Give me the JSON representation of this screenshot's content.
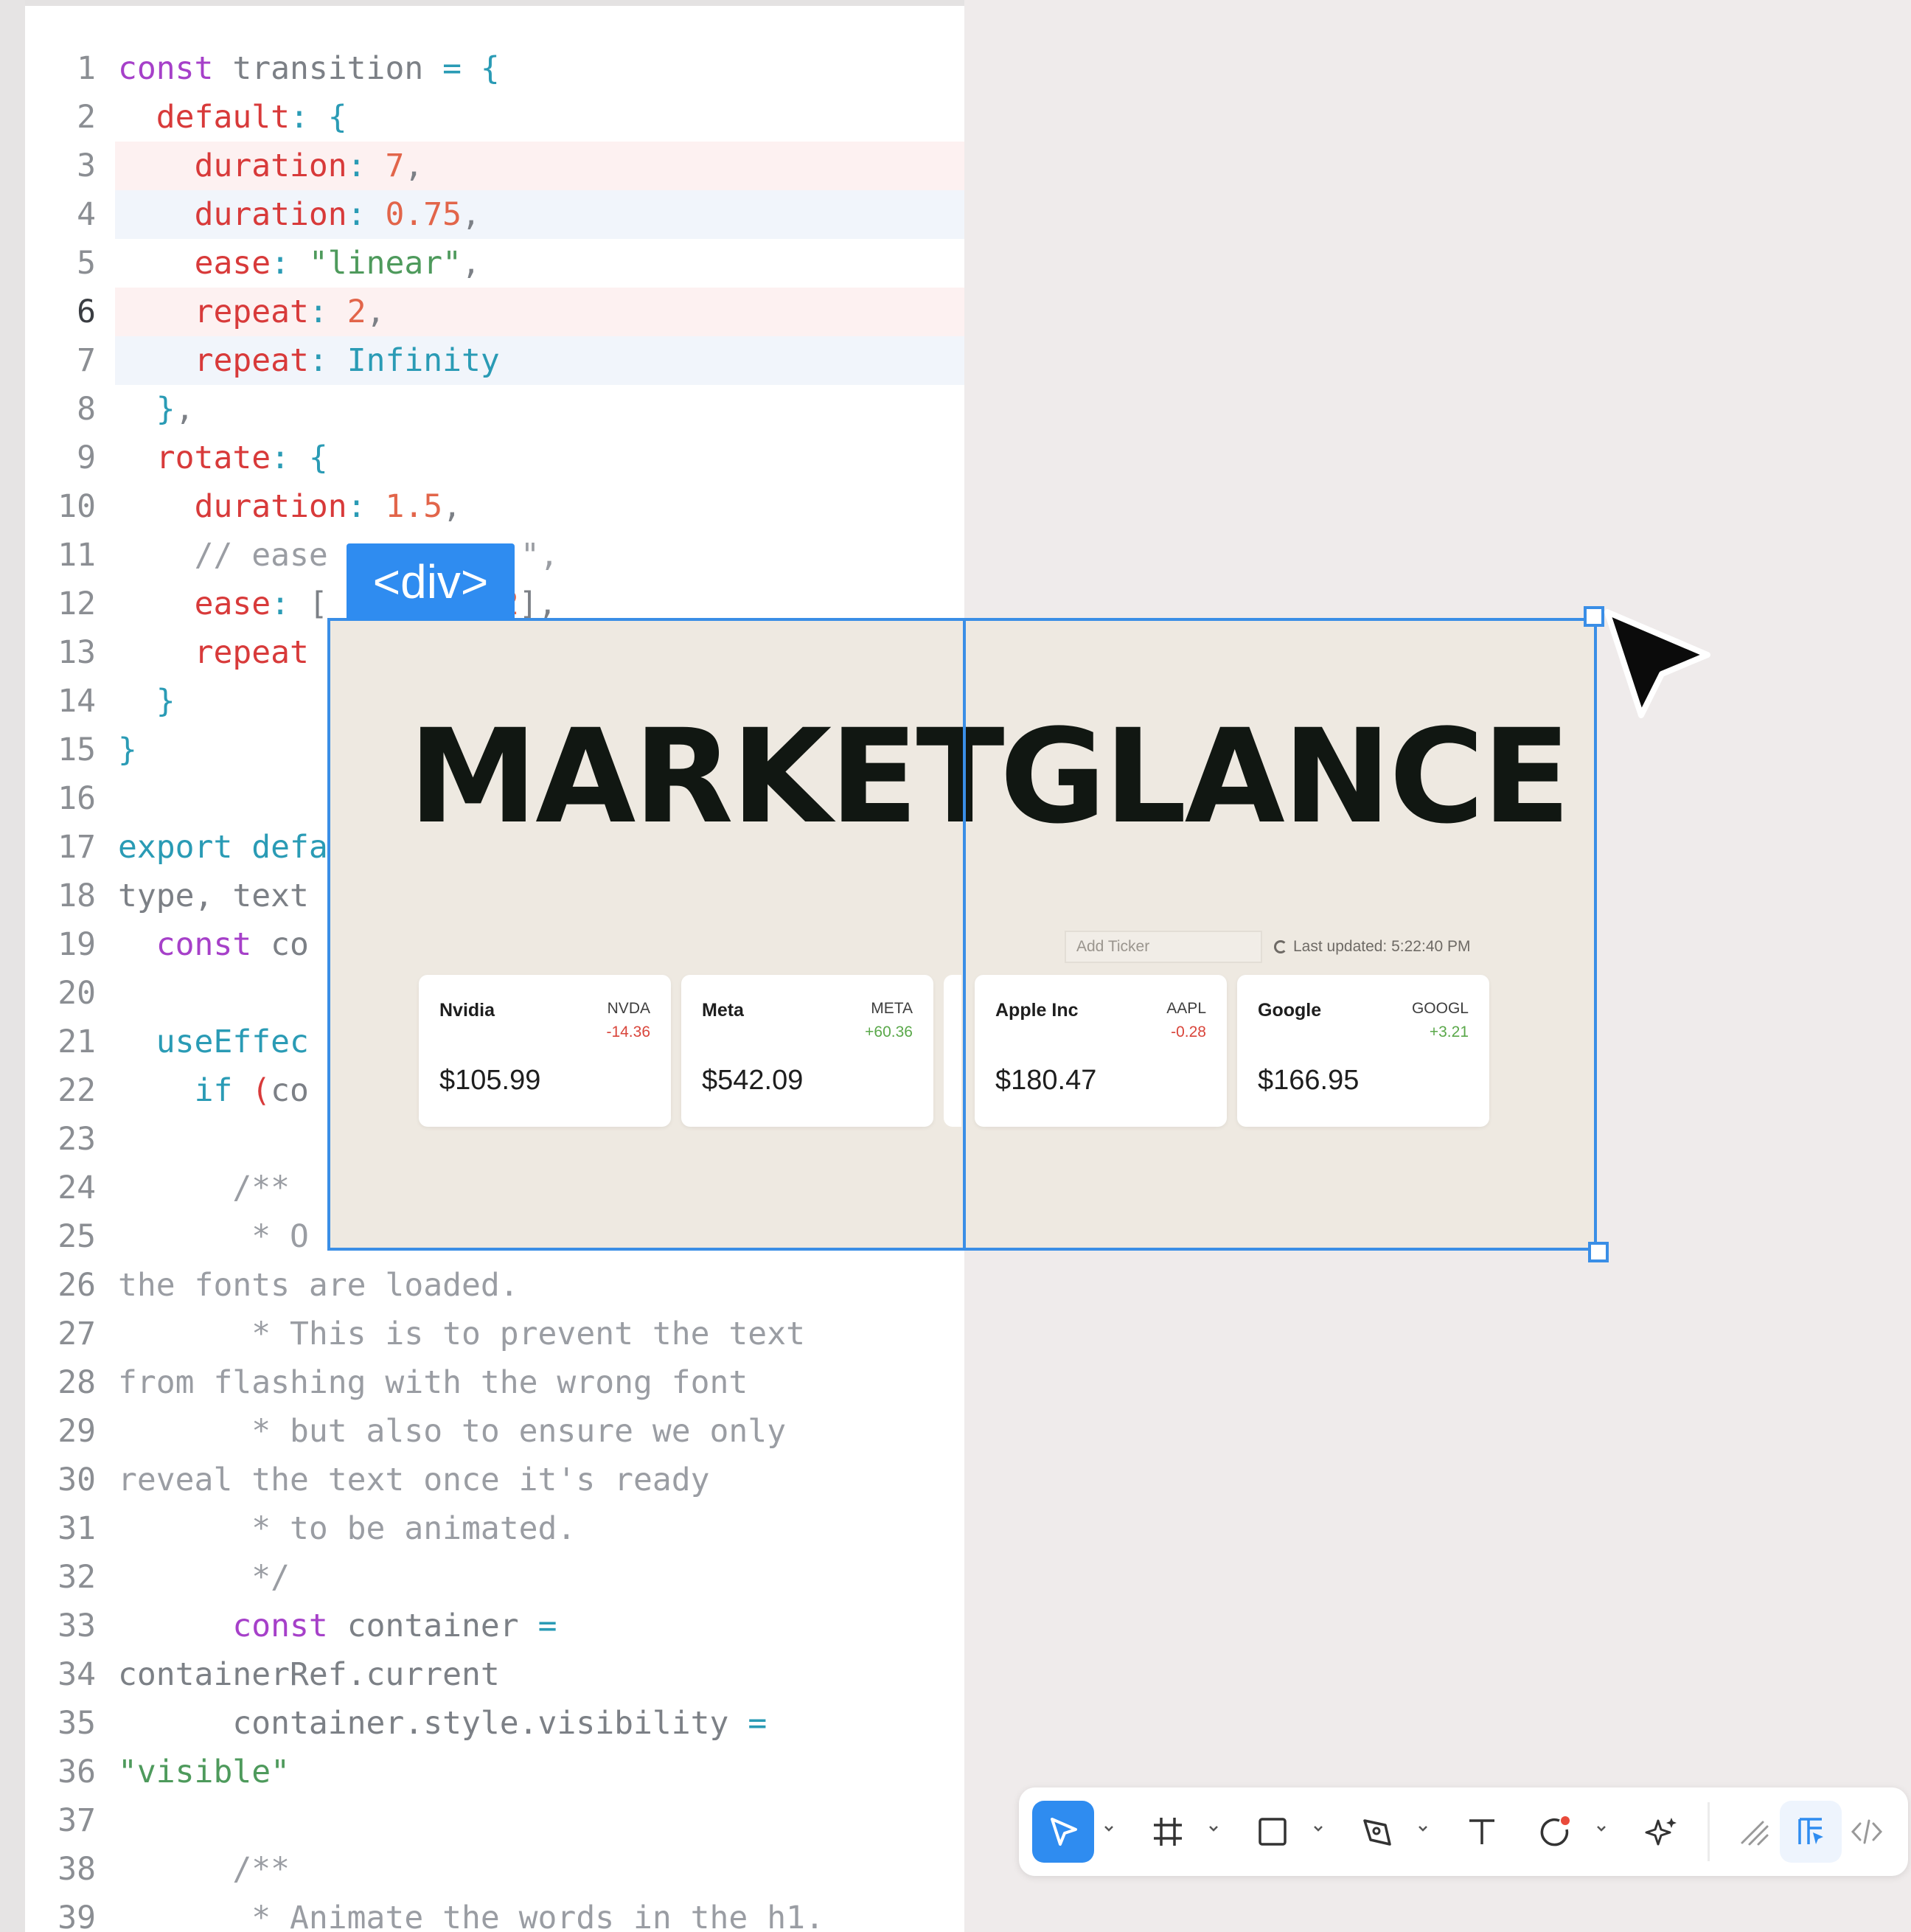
{
  "editor": {
    "lines": [
      {
        "n": "1",
        "diff": "",
        "html": "<span class='kw'>const</span> <span class='var'>transition</span> <span class='cyan'>=</span> <span class='cyan'>{</span>"
      },
      {
        "n": "2",
        "diff": "",
        "html": "  <span class='prop'>default</span><span class='cyan'>:</span> <span class='cyan'>{</span>"
      },
      {
        "n": "3",
        "diff": "del",
        "html": "    <span class='prop'>duration</span><span class='cyan'>:</span> <span class='num'>7</span><span class='var'>,</span>"
      },
      {
        "n": "4",
        "diff": "add",
        "html": "    <span class='prop'>duration</span><span class='cyan'>:</span> <span class='num'>0.75</span><span class='var'>,</span>"
      },
      {
        "n": "5",
        "diff": "",
        "html": "    <span class='prop'>ease</span><span class='cyan'>:</span> <span class='str'>\"linear\"</span><span class='var'>,</span>"
      },
      {
        "n": "6",
        "diff": "del",
        "active": true,
        "html": "    <span class='prop'>repeat</span><span class='cyan'>:</span> <span class='num'>2</span><span class='var'>,</span>"
      },
      {
        "n": "7",
        "diff": "add",
        "html": "    <span class='prop'>repeat</span><span class='cyan'>:</span> <span class='cyan'>Infinity</span>"
      },
      {
        "n": "8",
        "diff": "",
        "html": "  <span class='cyan'>}</span><span class='var'>,</span>"
      },
      {
        "n": "9",
        "diff": "",
        "html": "  <span class='prop'>rotate</span><span class='cyan'>:</span> <span class='cyan'>{</span>"
      },
      {
        "n": "10",
        "diff": "",
        "html": "    <span class='prop'>duration</span><span class='cyan'>:</span> <span class='num'>1.5</span><span class='var'>,</span>"
      },
      {
        "n": "11",
        "diff": "",
        "html": "    <span class='cmt'>// ease</span>"
      },
      {
        "n": "12",
        "diff": "",
        "html": "    <span class='prop'>ease</span><span class='cyan'>:</span> <span class='var'>[</span>      <span class='num'>4</span><span class='var'>,</span> <span class='num'>2</span><span class='var'>],</span>"
      },
      {
        "n": "13",
        "diff": "",
        "html": "    <span class='prop'>repeat</span>"
      },
      {
        "n": "14",
        "diff": "",
        "html": "  <span class='cyan'>}</span>"
      },
      {
        "n": "15",
        "diff": "",
        "html": "<span class='cyan'>}</span>"
      },
      {
        "n": "16",
        "diff": "",
        "html": ""
      },
      {
        "n": "17",
        "diff": "",
        "html": "<span class='cyan'>export</span> <span class='cyan'>defa</span>"
      },
      {
        "n": "18",
        "diff": "",
        "html": "<span class='var'>type, text</span>"
      },
      {
        "n": "19",
        "diff": "",
        "html": "  <span class='kw'>const</span> <span class='var'>co</span>"
      },
      {
        "n": "20",
        "diff": "",
        "html": ""
      },
      {
        "n": "21",
        "diff": "",
        "html": "  <span class='cyan'>useEffec</span>"
      },
      {
        "n": "22",
        "diff": "",
        "html": "    <span class='cyan'>if</span> <span class='prop'>(</span><span class='var'>co</span>"
      },
      {
        "n": "23",
        "diff": "",
        "html": ""
      },
      {
        "n": "24",
        "diff": "",
        "html": "      <span class='cmt'>/**</span>"
      },
      {
        "n": "25",
        "diff": "",
        "html": "       <span class='cmt'>* O</span>"
      },
      {
        "n": "26",
        "diff": "",
        "html": "<span class='cmt'>the fonts are loaded.</span>"
      },
      {
        "n": "27",
        "diff": "",
        "html": "       <span class='cmt'>* This is to prevent the text</span>"
      },
      {
        "n": "28",
        "diff": "",
        "html": "<span class='cmt'>from flashing with the wrong font</span>"
      },
      {
        "n": "29",
        "diff": "",
        "html": "       <span class='cmt'>* but also to ensure we only</span>"
      },
      {
        "n": "30",
        "diff": "",
        "html": "<span class='cmt'>reveal the text once it's ready</span>"
      },
      {
        "n": "31",
        "diff": "",
        "html": "       <span class='cmt'>* to be animated.</span>"
      },
      {
        "n": "32",
        "diff": "",
        "html": "       <span class='cmt'>*/</span>"
      },
      {
        "n": "33",
        "diff": "",
        "html": "      <span class='kw'>const</span> <span class='var'>container</span> <span class='cyan'>=</span>"
      },
      {
        "n": "34",
        "diff": "",
        "html": "<span class='var'>containerRef.current</span>"
      },
      {
        "n": "35",
        "diff": "",
        "html": "      <span class='var'>container.style.visibility</span> <span class='cyan'>=</span>"
      },
      {
        "n": "36",
        "diff": "",
        "html": "<span class='str'>\"visible\"</span>"
      },
      {
        "n": "37",
        "diff": "",
        "html": ""
      },
      {
        "n": "38",
        "diff": "",
        "html": "      <span class='cmt'>/**</span>"
      },
      {
        "n": "39",
        "diff": "",
        "html": "       <span class='cmt'>* Animate the words in the h1.</span>"
      }
    ],
    "line11_overflow": "\",",
    "line12_overlay_tail": ""
  },
  "selection": {
    "tag_label": "<div>"
  },
  "preview": {
    "headline_left": "MARKET",
    "headline_right": "GLANCE",
    "ticker_placeholder": "Add Ticker",
    "last_updated": "Last updated: 5:22:40 PM",
    "cards": [
      {
        "name": "Nvidia",
        "symbol": "NVDA",
        "change": "-14.36",
        "direction": "neg",
        "price": "$105.99"
      },
      {
        "name": "Meta",
        "symbol": "META",
        "change": "+60.36",
        "direction": "pos",
        "price": "$542.09"
      },
      {
        "name": "Apple Inc",
        "symbol": "AAPL",
        "change": "-0.28",
        "direction": "neg",
        "price": "$180.47"
      },
      {
        "name": "Google",
        "symbol": "GOOGL",
        "change": "+3.21",
        "direction": "pos",
        "price": "$166.95"
      }
    ]
  },
  "toolbar": {
    "tools": [
      "select-tool-icon",
      "frame-tool-icon",
      "rectangle-tool-icon",
      "pen-tool-icon",
      "text-tool-icon",
      "shape-tool-icon",
      "ai-sparkle-icon",
      "draw-mode-icon",
      "design-mode-icon",
      "code-mode-icon"
    ],
    "active_tool": "select-tool-icon",
    "accent": "#2f8cf0"
  }
}
